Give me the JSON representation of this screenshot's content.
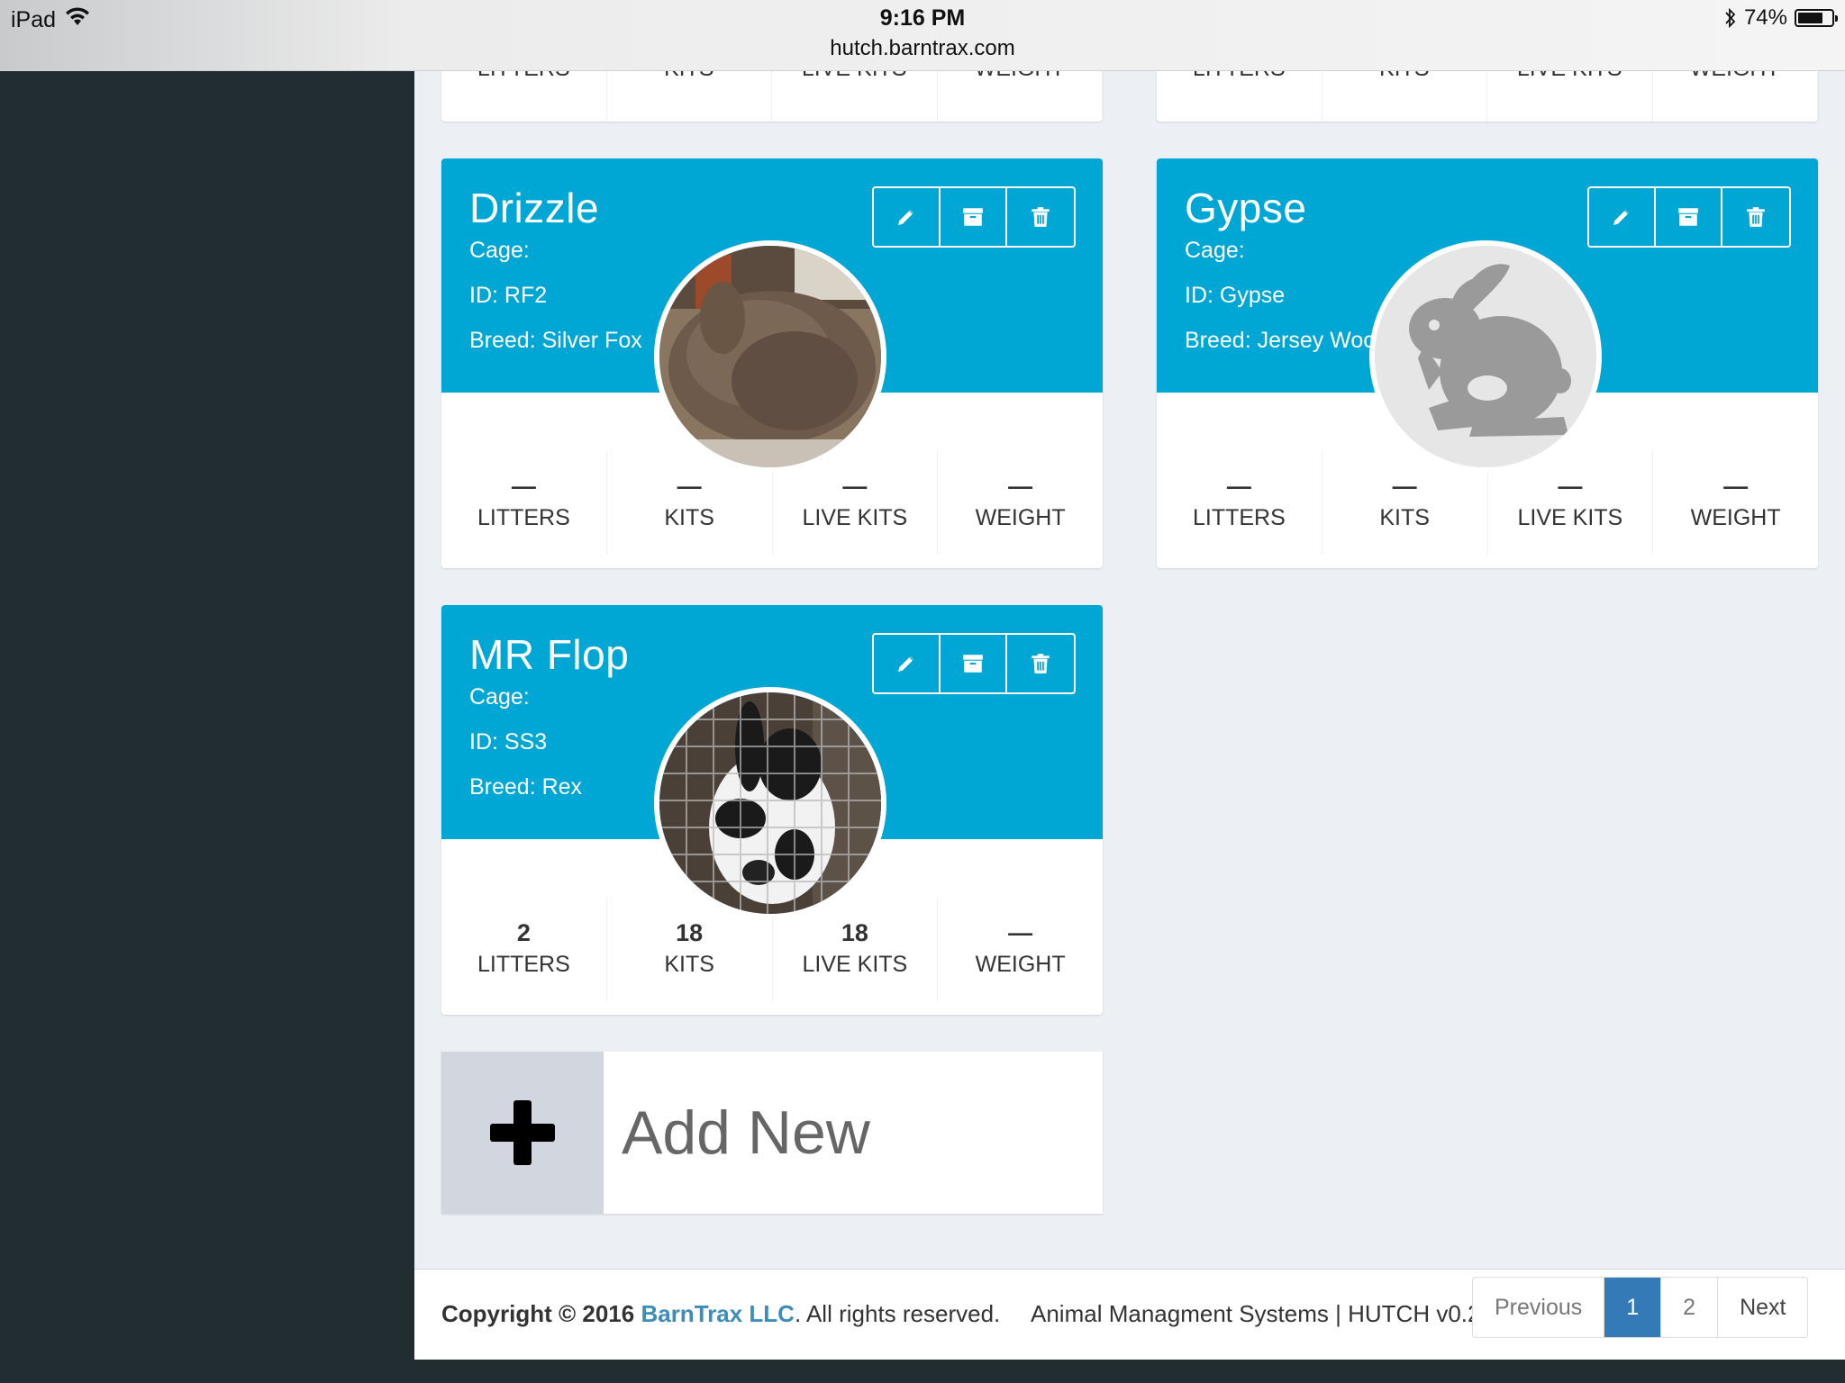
{
  "status_bar": {
    "device": "iPad",
    "time": "9:16 PM",
    "url": "hutch.barntrax.com",
    "battery": "74%",
    "battery_level": 0.74
  },
  "partial_row": {
    "left": [
      "LITTERS",
      "KITS",
      "LIVE KITS",
      "WEIGHT"
    ],
    "right": [
      "LITTERS",
      "KITS",
      "LIVE KITS",
      "WEIGHT"
    ]
  },
  "cards": [
    {
      "name": "Drizzle",
      "cage": "Cage:",
      "id": "ID: RF2",
      "breed": "Breed: Silver Fox",
      "stats": [
        {
          "value": "—",
          "label": "LITTERS"
        },
        {
          "value": "—",
          "label": "KITS"
        },
        {
          "value": "—",
          "label": "LIVE KITS"
        },
        {
          "value": "—",
          "label": "WEIGHT"
        }
      ]
    },
    {
      "name": "Gypse",
      "cage": "Cage:",
      "id": "ID: Gypse",
      "breed": "Breed: Jersey Woc",
      "stats": [
        {
          "value": "—",
          "label": "LITTERS"
        },
        {
          "value": "—",
          "label": "KITS"
        },
        {
          "value": "—",
          "label": "LIVE KITS"
        },
        {
          "value": "—",
          "label": "WEIGHT"
        }
      ]
    },
    {
      "name": "MR Flop",
      "cage": "Cage:",
      "id": "ID: SS3",
      "breed": "Breed: Rex",
      "stats": [
        {
          "value": "2",
          "label": "LITTERS"
        },
        {
          "value": "18",
          "label": "KITS"
        },
        {
          "value": "18",
          "label": "LIVE KITS"
        },
        {
          "value": "—",
          "label": "WEIGHT"
        }
      ]
    }
  ],
  "add_new": {
    "label": "Add New"
  },
  "footer": {
    "copyright_prefix": "Copyright © 2016",
    "brand": "BarnTrax LLC",
    "copyright_suffix": ". All rights reserved.",
    "system": "Animal Managment Systems | HUTCH v0.2"
  },
  "pagination": {
    "previous": "Previous",
    "page1": "1",
    "page2": "2",
    "next": "Next"
  },
  "icons": {
    "edit": "pencil-icon",
    "archive": "archive-icon",
    "delete": "trash-icon",
    "add": "plus-icon",
    "placeholder": "rabbit-silhouette-icon"
  },
  "colors": {
    "card_header": "#00a7d4",
    "sidebar": "#222d32",
    "content_bg": "#ecf0f5",
    "active_page": "#337ab7",
    "brand_link": "#3c8dbc"
  }
}
